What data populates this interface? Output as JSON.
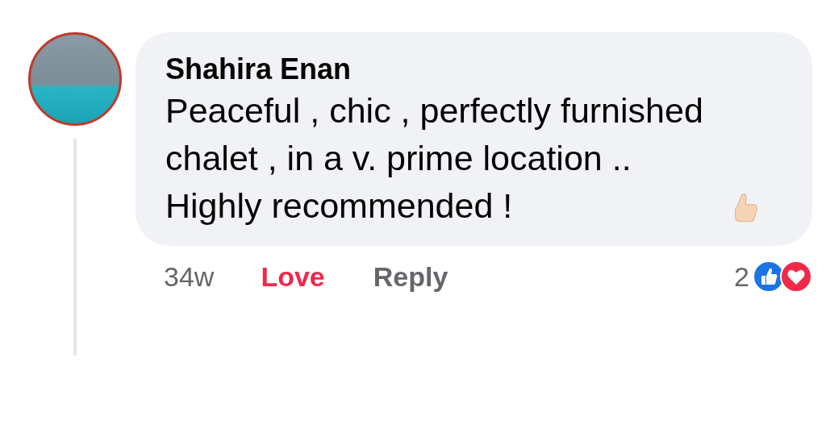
{
  "comment": {
    "author": "Shahira Enan",
    "text": "Peaceful , chic , perfectly furnished chalet , in a v. prime location .. Highly recommended !",
    "time": "34w",
    "actions": [
      {
        "label": "Love",
        "active": true
      },
      {
        "label": "Reply",
        "active": false
      }
    ],
    "reactions": {
      "count": "2",
      "types": [
        {
          "kind": "like"
        },
        {
          "kind": "love"
        }
      ]
    }
  }
}
